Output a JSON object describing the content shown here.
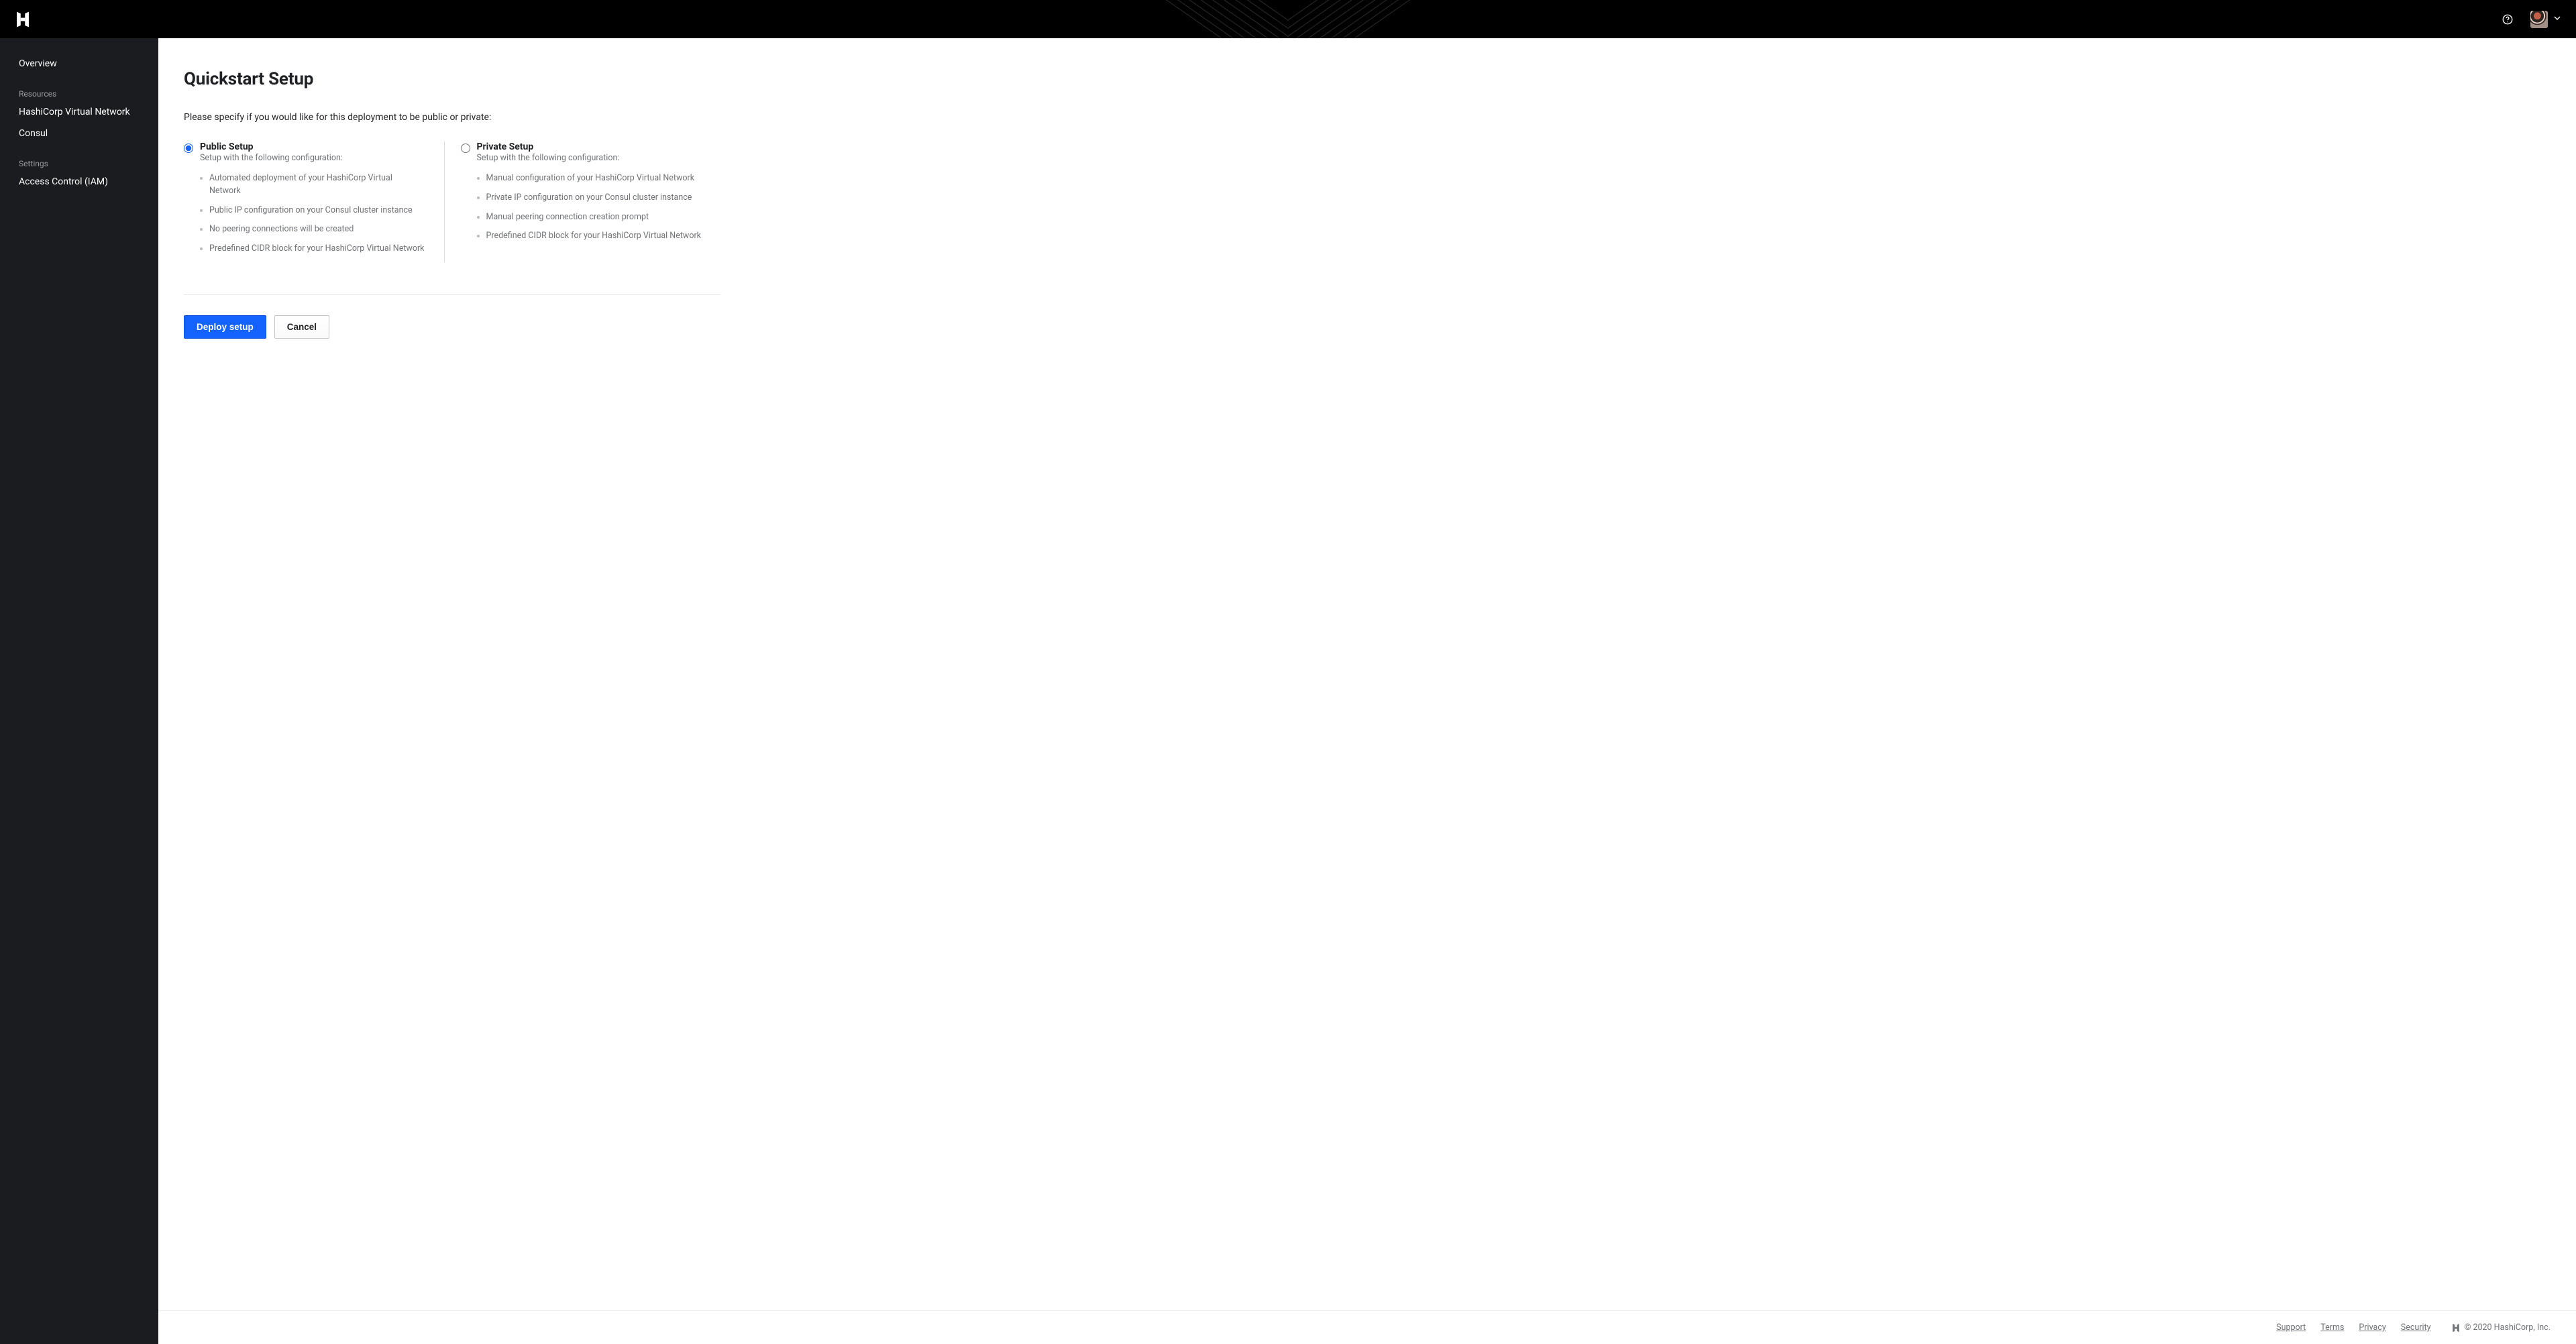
{
  "sidebar": {
    "overview": "Overview",
    "section_resources": "Resources",
    "hvn": "HashiCorp Virtual Network",
    "consul": "Consul",
    "section_settings": "Settings",
    "iam": "Access Control (IAM)"
  },
  "page": {
    "title": "Quickstart Setup",
    "intro": "Please specify if you would like for this deployment to be public or private:"
  },
  "options": {
    "public": {
      "title": "Public Setup",
      "sub": "Setup with the following configuration:",
      "items": [
        "Automated deployment of your HashiCorp Virtual Network",
        "Public IP configuration on your Consul cluster instance",
        "No peering connections will be created",
        "Predefined CIDR block for your HashiCorp Virtual Network"
      ]
    },
    "private": {
      "title": "Private Setup",
      "sub": "Setup with the following configuration:",
      "items": [
        "Manual configuration of your HashiCorp Virtual Network",
        "Private IP configuration on your Consul cluster instance",
        "Manual peering connection creation prompt",
        "Predefined CIDR block for your HashiCorp Virtual Network"
      ]
    }
  },
  "actions": {
    "deploy": "Deploy setup",
    "cancel": "Cancel"
  },
  "footer": {
    "support": "Support",
    "terms": "Terms",
    "privacy": "Privacy",
    "security": "Security",
    "copyright": "© 2020 HashiCorp, Inc."
  }
}
